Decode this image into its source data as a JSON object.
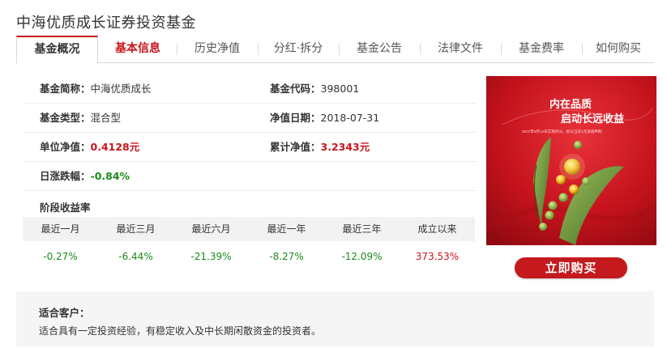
{
  "fund_name": "中海优质成长证券投资基金",
  "tabs": [
    {
      "label": "基金概况"
    },
    {
      "label": "基本信息"
    },
    {
      "label": "历史净值"
    },
    {
      "label": "分红·拆分"
    },
    {
      "label": "基金公告"
    },
    {
      "label": "法律文件"
    },
    {
      "label": "基金费率"
    },
    {
      "label": "如何购买"
    }
  ],
  "info": {
    "abbr_label": "基金简称：",
    "abbr_value": "中海优质成长",
    "code_label": "基金代码：",
    "code_value": "398001",
    "type_label": "基金类型：",
    "type_value": "混合型",
    "date_label": "净值日期：",
    "date_value": "2018-07-31",
    "unit_nav_label": "单位净值：",
    "unit_nav_value": "0.4128元",
    "acc_nav_label": "累计净值：",
    "acc_nav_value": "3.2343元",
    "daily_label": "日涨跌幅：",
    "daily_value": "-0.84%"
  },
  "performance": {
    "title": "阶段收益率",
    "headers": [
      "最近一月",
      "最近三月",
      "最近六月",
      "最近一年",
      "最近三年",
      "成立以来"
    ],
    "values": [
      "-0.27%",
      "-6.44%",
      "-21.39%",
      "-8.27%",
      "-12.09%",
      "373.53%"
    ]
  },
  "banner": {
    "line1": "内在品质",
    "line2": "启动长远收益",
    "small": "2007年9月14日实施拆分，拆分当日1元净值申购"
  },
  "buy_label": "立即购买",
  "clients": {
    "title": "适合客户：",
    "text": "适合具有一定投资经验，有稳定收入及中长期闲散资金的投资者。"
  },
  "colors": {
    "accent_red": "#c8161d",
    "negative_green": "#1a8a1a",
    "banner_red": "#c41a1e"
  }
}
